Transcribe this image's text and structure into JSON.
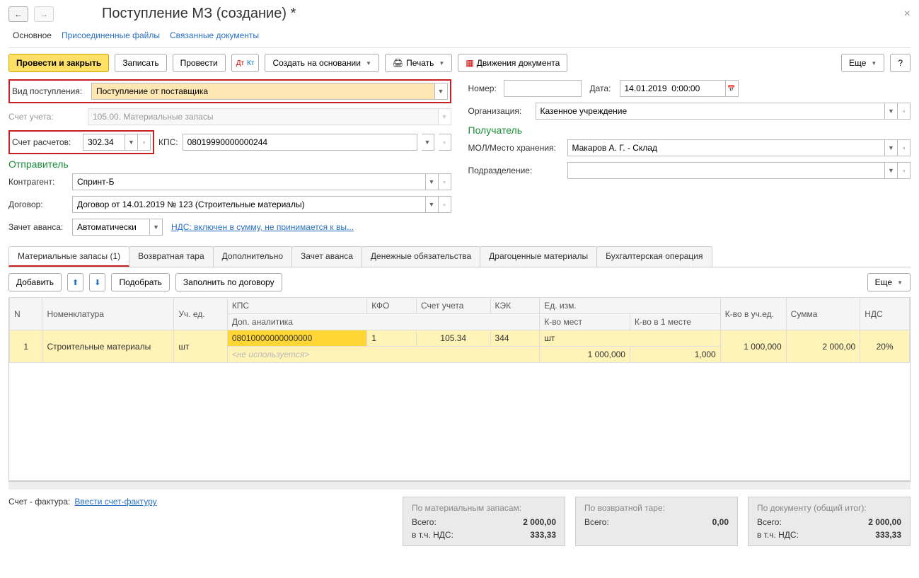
{
  "title": "Поступление МЗ (создание) *",
  "topnav": {
    "main": "Основное",
    "files": "Присоединенные файлы",
    "related": "Связанные документы"
  },
  "toolbar": {
    "post_close": "Провести и закрыть",
    "write": "Записать",
    "post": "Провести",
    "create_based": "Создать на основании",
    "print": "Печать",
    "movements": "Движения документа",
    "more": "Еще",
    "help": "?"
  },
  "fields": {
    "entry_type_label": "Вид поступления:",
    "entry_type": "Поступление от поставщика",
    "account_label": "Счет учета:",
    "account": "105.00. Материальные запасы",
    "settlement_label": "Счет расчетов:",
    "settlement": "302.34",
    "kps_label": "КПС:",
    "kps": "08019990000000244",
    "sender_title": "Отправитель",
    "counterparty_label": "Контрагент:",
    "counterparty": "Спринт-Б",
    "contract_label": "Договор:",
    "contract": "Договор от 14.01.2019 № 123 (Строительные материалы)",
    "advance_label": "Зачет аванса:",
    "advance": "Автоматически",
    "nds_link": "НДС: включен в сумму, не принимается к вы...",
    "number_label": "Номер:",
    "number": "",
    "date_label": "Дата:",
    "date": "14.01.2019  0:00:00",
    "org_label": "Организация:",
    "org": "Казенное учреждение",
    "receiver_title": "Получатель",
    "mol_label": "МОЛ/Место хранения:",
    "mol": "Макаров А. Г. - Склад",
    "dept_label": "Подразделение:",
    "dept": ""
  },
  "tabs": {
    "materials": "Материальные запасы (1)",
    "packaging": "Возвратная тара",
    "extra": "Дополнительно",
    "advance": "Зачет аванса",
    "liabilities": "Денежные обязательства",
    "precious": "Драгоценные материалы",
    "accounting": "Бухгалтерская операция"
  },
  "tab_toolbar": {
    "add": "Добавить",
    "pick": "Подобрать",
    "fill": "Заполнить по договору",
    "more": "Еще"
  },
  "table": {
    "headers": {
      "n": "N",
      "nomen": "Номенклатура",
      "unit": "Уч. ед.",
      "kps": "КПС",
      "kfo": "КФО",
      "acct": "Счет учета",
      "kek": "КЭК",
      "measure": "Ед. изм.",
      "qty": "К-во в уч.ед.",
      "sum": "Сумма",
      "nds": "НДС",
      "dop": "Доп. аналитика",
      "places": "К-во мест",
      "inplace": "К-во в 1 месте"
    },
    "row": {
      "n": "1",
      "nomen": "Строительные материалы",
      "unit": "шт",
      "kps": "08010000000000000",
      "kfo": "1",
      "acct": "105.34",
      "kek": "344",
      "measure": "шт",
      "qty": "1 000,000",
      "sum": "2 000,00",
      "nds": "20%",
      "dop": "<не используется>",
      "places": "1 000,000",
      "inplace": "1,000"
    }
  },
  "footer": {
    "invoice_label": "Счет - фактура:",
    "invoice_link": "Ввести счет-фактуру",
    "box1_title": "По материальным запасам:",
    "box2_title": "По возвратной таре:",
    "box3_title": "По документу (общий итог):",
    "total_label": "Всего:",
    "nds_label": "в т.ч. НДС:",
    "box1_total": "2 000,00",
    "box1_nds": "333,33",
    "box2_total": "0,00",
    "box3_total": "2 000,00",
    "box3_nds": "333,33"
  }
}
